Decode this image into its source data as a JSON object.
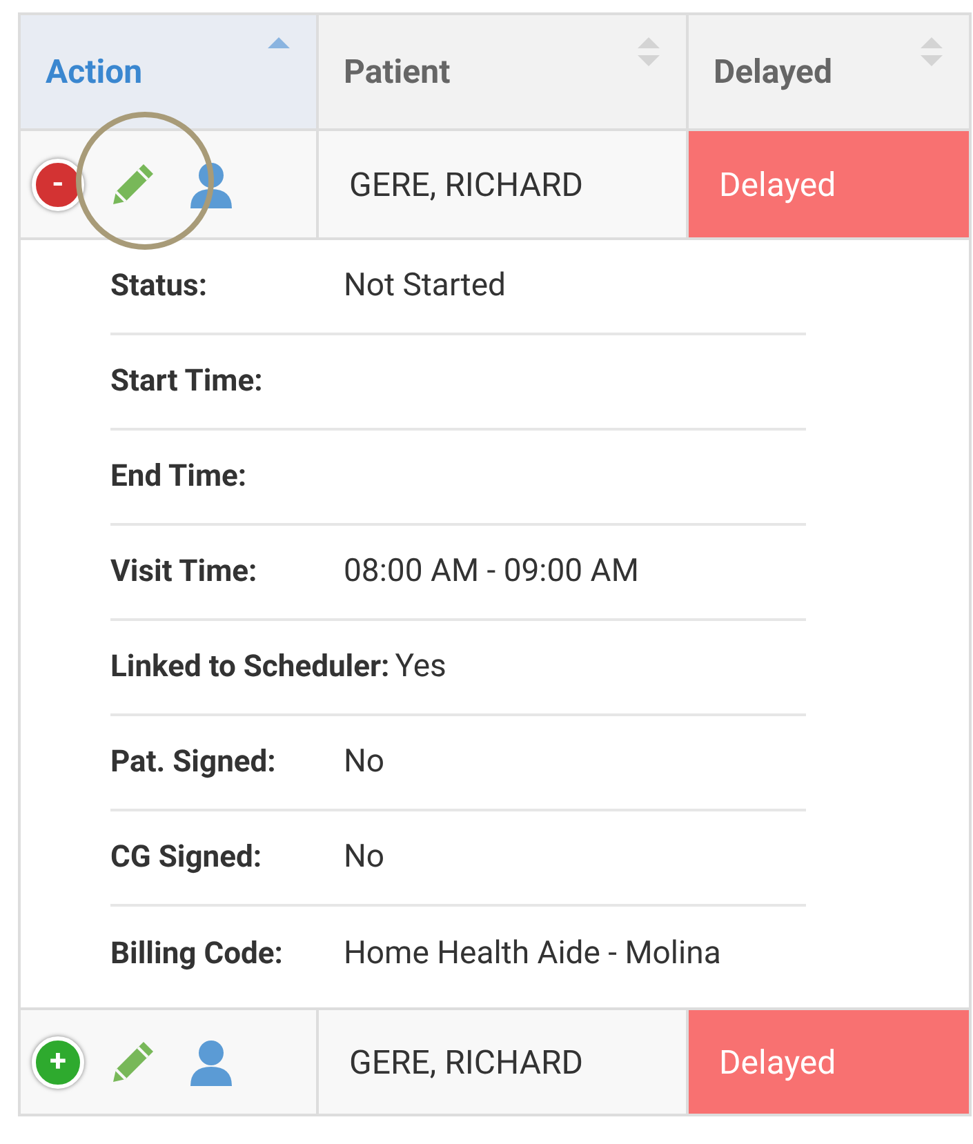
{
  "table": {
    "columns": [
      {
        "label": "Action",
        "sorted": true
      },
      {
        "label": "Patient",
        "sorted": false
      },
      {
        "label": "Delayed",
        "sorted": false
      }
    ],
    "rows": [
      {
        "toggle": "-",
        "expanded": true,
        "edit_highlighted": true,
        "patient": "GERE, RICHARD",
        "delayed": "Delayed",
        "details": [
          {
            "label": "Status:",
            "value": "Not Started"
          },
          {
            "label": "Start Time:"
          },
          {
            "label": "End Time:"
          },
          {
            "label": "Visit Time:",
            "value": "08:00 AM - 09:00 AM"
          },
          {
            "label": "Linked to Scheduler:",
            "value": "Yes"
          },
          {
            "label": "Pat. Signed:",
            "value": "No"
          },
          {
            "label": "CG Signed:",
            "value": "No"
          },
          {
            "label": "Billing Code:",
            "value": "Home Health Aide - Molina"
          }
        ]
      },
      {
        "toggle": "+",
        "expanded": false,
        "edit_highlighted": false,
        "patient": "GERE, RICHARD",
        "delayed": "Delayed"
      }
    ]
  }
}
